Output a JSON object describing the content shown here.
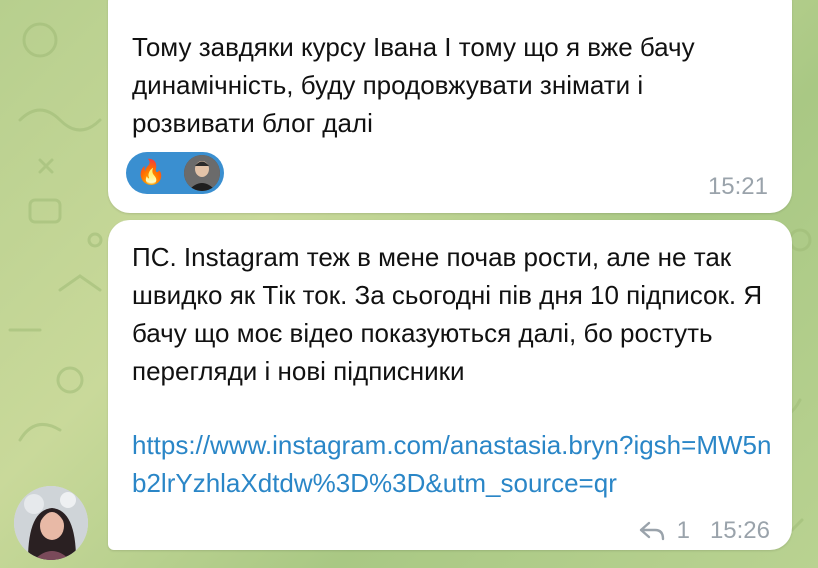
{
  "messages": [
    {
      "text": "Тому завдяки курсу Івана І тому що я вже бачу динамічність, буду продовжувати знімати і розвивати блог далі",
      "reaction": {
        "emoji": "🔥",
        "reactor_icon": "reactor-avatar"
      },
      "time": "15:21"
    },
    {
      "text": "ПС. Instagram теж в мене почав рости, але не так швидко як Тік ток. За сьогодні пів дня 10 підписок. Я бачу що моє відео показуються далі, бо ростуть перегляди і нові підписники",
      "link": "https://www.instagram.com/anastasia.bryn?igsh=MW5nb2lrYzhlaXdtdw%3D%3D&utm_source=qr",
      "reply_count": "1",
      "time": "15:26"
    }
  ],
  "colors": {
    "background": "#b7cf8e",
    "bubble": "#ffffff",
    "link": "#2a86c7",
    "reaction": "#3a8fd0",
    "meta": "#9aa3ab"
  }
}
